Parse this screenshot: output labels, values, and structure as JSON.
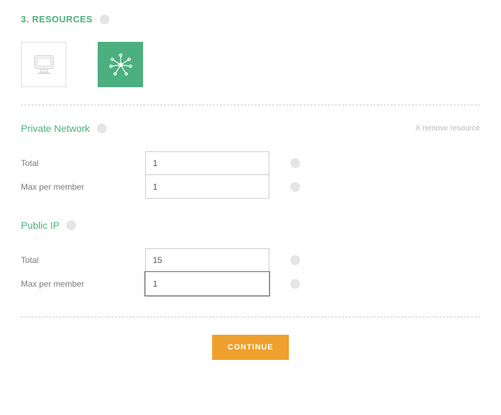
{
  "section": {
    "title": "3. RESOURCES"
  },
  "icons": {
    "computer": "computer-resource",
    "network": "network-resource"
  },
  "private_network": {
    "title": "Private Network",
    "remove_label": "X remove resource",
    "total_label": "Total",
    "total_value": "1",
    "max_label": "Max per member",
    "max_value": "1"
  },
  "public_ip": {
    "title": "Public IP",
    "total_label": "Total",
    "total_value": "15",
    "max_label": "Max per member",
    "max_value": "1"
  },
  "continue_label": "CONTINUE"
}
